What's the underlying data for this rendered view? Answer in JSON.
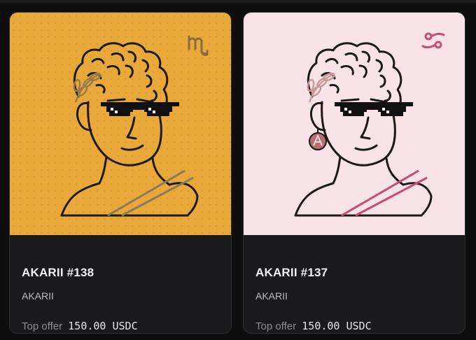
{
  "cards": [
    {
      "title": "AKARII #138",
      "collection": "AKARII",
      "offer_label": "Top offer",
      "offer_amount": "150.00 USDC",
      "bg_color": "#e9a93a",
      "accent_color": "#9a7a4a",
      "zodiac_icon": "scorpio-icon"
    },
    {
      "title": "AKARII #137",
      "collection": "AKARII",
      "offer_label": "Top offer",
      "offer_amount": "150.00 USDC",
      "bg_color": "#f8e3e8",
      "accent_color": "#c84b78",
      "zodiac_icon": "cancer-icon"
    }
  ]
}
